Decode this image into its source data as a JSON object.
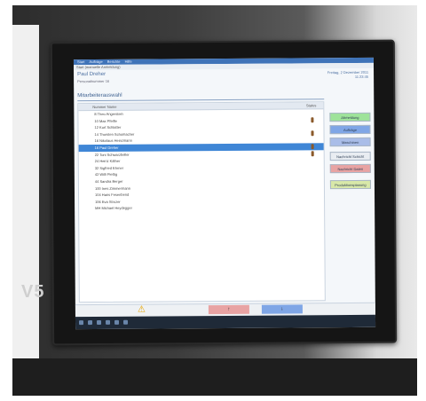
{
  "menubar": [
    "Start",
    "Aufträge",
    "Berichte",
    "Hilfe"
  ],
  "window_title": "Start (manuelle Anmeldung)",
  "user": {
    "name": "Paul Dreher",
    "number": "Personalnummer 16"
  },
  "datetime": {
    "date": "Freitag, 2 Dezember 2011",
    "time": "11:23:45"
  },
  "section_title": "Mitarbeiterauswahl",
  "table": {
    "col_name": "Nummer Name",
    "col_status": "Status",
    "rows": [
      {
        "text": "8 Theo Angerstein",
        "status": false
      },
      {
        "text": "10 Max Pfeifle",
        "status": true
      },
      {
        "text": "12 Kurt Schlatter",
        "status": false
      },
      {
        "text": "14 Thorsten Schumacher",
        "status": true
      },
      {
        "text": "16 Nikolaus Heinzmann",
        "status": false
      },
      {
        "text": "16 Paul Dreher",
        "status": true,
        "selected": true
      },
      {
        "text": "22 Toni Schwarzbeller",
        "status": true
      },
      {
        "text": "24 Heinz Käfner",
        "status": false
      },
      {
        "text": "32 Sigfried Ehrner",
        "status": false
      },
      {
        "text": "42 Willi Pießig",
        "status": false
      },
      {
        "text": "44 Sandra Berger",
        "status": false
      },
      {
        "text": "100 Ines Zimmermann",
        "status": false
      },
      {
        "text": "104 Hans Fesenbend",
        "status": false
      },
      {
        "text": "106 Eva Strozer",
        "status": false
      },
      {
        "text": "MH Michael Heydegger",
        "status": false
      }
    ]
  },
  "sidebuttons": [
    {
      "label": "Abmeldung",
      "color": "#9ee39a"
    },
    {
      "label": "Aufträge",
      "color": "#7fa6e6"
    },
    {
      "label": "Maschinen",
      "color": "#a9bde8"
    },
    {
      "label": "Nachricht Schicht",
      "color": "#e9edf2"
    },
    {
      "label": "Nachricht Daten",
      "color": "#e8a3a3"
    },
    {
      "label": "Produktionsplanung",
      "color": "#d8e8a8"
    }
  ],
  "footer": {
    "up_arrow": "↑",
    "down_arrow": "↓"
  },
  "machine_text": "V5"
}
